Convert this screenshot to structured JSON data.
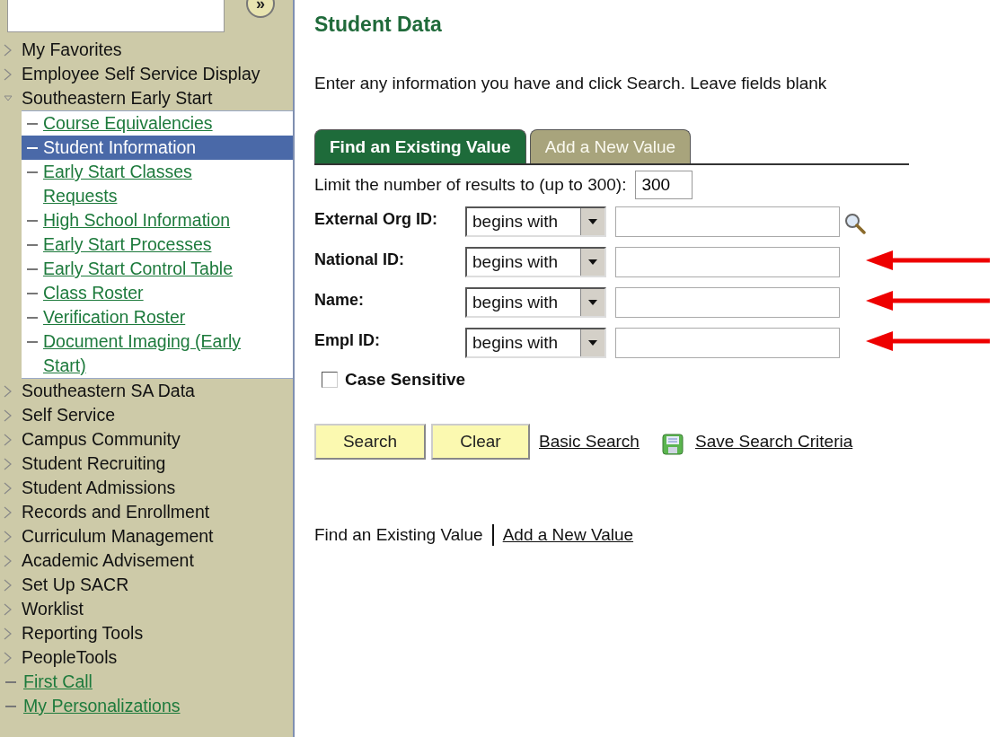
{
  "sidebar": {
    "expand_button": "»",
    "items": [
      {
        "kind": "folder",
        "label": "My Favorites",
        "expanded": false
      },
      {
        "kind": "folder",
        "label": "Employee Self Service Display",
        "expanded": false
      },
      {
        "kind": "folder",
        "label": "Southeastern Early Start",
        "expanded": true,
        "children": [
          {
            "label": "Course Equivalencies",
            "selected": false
          },
          {
            "label": "Student Information",
            "selected": true
          },
          {
            "label": "Early Start Classes Requests",
            "selected": false
          },
          {
            "label": "High School Information",
            "selected": false
          },
          {
            "label": "Early Start Processes",
            "selected": false
          },
          {
            "label": "Early Start Control Table",
            "selected": false
          },
          {
            "label": "Class Roster",
            "selected": false
          },
          {
            "label": "Verification Roster",
            "selected": false
          },
          {
            "label": "Document Imaging (Early Start)",
            "selected": false
          }
        ]
      },
      {
        "kind": "folder",
        "label": "Southeastern SA Data",
        "expanded": false
      },
      {
        "kind": "folder",
        "label": "Self Service",
        "expanded": false
      },
      {
        "kind": "folder",
        "label": "Campus Community",
        "expanded": false
      },
      {
        "kind": "folder",
        "label": "Student Recruiting",
        "expanded": false
      },
      {
        "kind": "folder",
        "label": "Student Admissions",
        "expanded": false
      },
      {
        "kind": "folder",
        "label": "Records and Enrollment",
        "expanded": false
      },
      {
        "kind": "folder",
        "label": "Curriculum Management",
        "expanded": false
      },
      {
        "kind": "folder",
        "label": "Academic Advisement",
        "expanded": false
      },
      {
        "kind": "folder",
        "label": "Set Up SACR",
        "expanded": false
      },
      {
        "kind": "folder",
        "label": "Worklist",
        "expanded": false
      },
      {
        "kind": "folder",
        "label": "Reporting Tools",
        "expanded": false
      },
      {
        "kind": "folder",
        "label": "PeopleTools",
        "expanded": false
      },
      {
        "kind": "link",
        "label": "First Call"
      },
      {
        "kind": "link",
        "label": "My Personalizations"
      }
    ]
  },
  "page": {
    "title": "Student Data",
    "instructions": "Enter any information you have and click Search. Leave fields blank",
    "tabs": [
      {
        "label": "Find an Existing Value",
        "selected": true
      },
      {
        "label": "Add a New Value",
        "selected": false
      }
    ],
    "limit": {
      "label": "Limit the number of results to (up to 300):",
      "value": "300"
    },
    "fields": [
      {
        "label": "External Org ID:",
        "operator": "begins with",
        "lookup": true,
        "arrow": false
      },
      {
        "label": "National ID:",
        "operator": "begins with",
        "lookup": false,
        "arrow": true
      },
      {
        "label": "Name:",
        "operator": "begins with",
        "lookup": false,
        "arrow": true
      },
      {
        "label": "Empl ID:",
        "operator": "begins with",
        "lookup": false,
        "arrow": true
      }
    ],
    "case_sensitive": {
      "label": "Case Sensitive",
      "checked": false
    },
    "buttons": [
      "Search",
      "Clear"
    ],
    "links": [
      {
        "kind": "link",
        "label": "Basic Search"
      },
      {
        "kind": "save",
        "label": "Save Search Criteria"
      }
    ],
    "footer": {
      "current": "Find an Existing Value",
      "link": "Add a New Value"
    }
  }
}
